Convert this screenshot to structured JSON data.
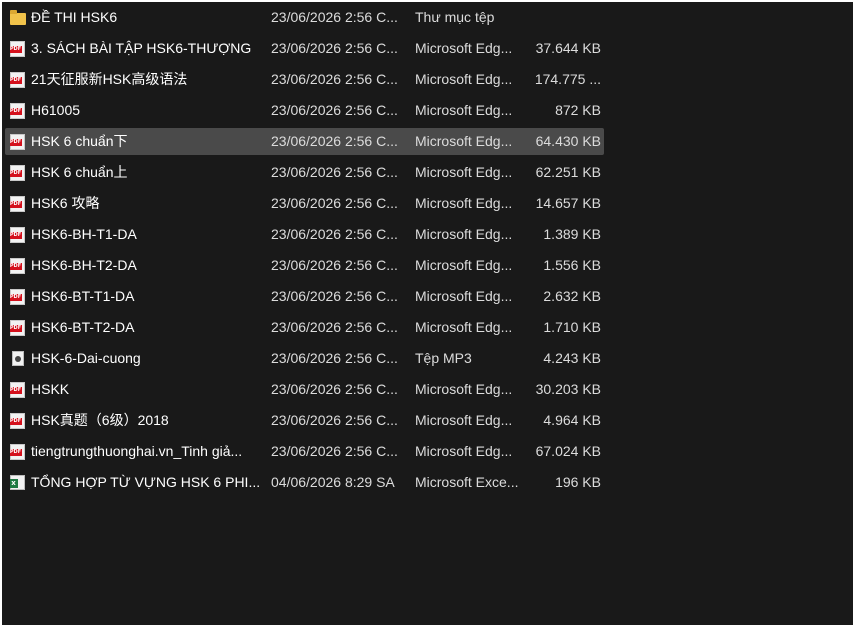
{
  "files": [
    {
      "name": "ĐỀ THI HSK6",
      "date": "23/06/2026 2:56 C...",
      "type": "Thư mục tệp",
      "size": "",
      "icon": "folder-icon"
    },
    {
      "name": "3. SÁCH BÀI TẬP HSK6-THƯỢNG",
      "date": "23/06/2026 2:56 C...",
      "type": "Microsoft Edg...",
      "size": "37.644 KB",
      "icon": "pdf-icon"
    },
    {
      "name": "21天征服新HSK高级语法",
      "date": "23/06/2026 2:56 C...",
      "type": "Microsoft Edg...",
      "size": "174.775 ...",
      "icon": "pdf-icon"
    },
    {
      "name": "H61005",
      "date": "23/06/2026 2:56 C...",
      "type": "Microsoft Edg...",
      "size": "872 KB",
      "icon": "pdf-icon"
    },
    {
      "name": "HSK 6  chuẩn下",
      "date": "23/06/2026 2:56 C...",
      "type": "Microsoft Edg...",
      "size": "64.430 KB",
      "icon": "pdf-icon",
      "selected": true
    },
    {
      "name": "HSK 6 chuẩn上",
      "date": "23/06/2026 2:56 C...",
      "type": "Microsoft Edg...",
      "size": "62.251 KB",
      "icon": "pdf-icon"
    },
    {
      "name": "HSK6 攻略",
      "date": "23/06/2026 2:56 C...",
      "type": "Microsoft Edg...",
      "size": "14.657 KB",
      "icon": "pdf-icon"
    },
    {
      "name": "HSK6-BH-T1-DA",
      "date": "23/06/2026 2:56 C...",
      "type": "Microsoft Edg...",
      "size": "1.389 KB",
      "icon": "pdf-icon"
    },
    {
      "name": "HSK6-BH-T2-DA",
      "date": "23/06/2026 2:56 C...",
      "type": "Microsoft Edg...",
      "size": "1.556 KB",
      "icon": "pdf-icon"
    },
    {
      "name": "HSK6-BT-T1-DA",
      "date": "23/06/2026 2:56 C...",
      "type": "Microsoft Edg...",
      "size": "2.632 KB",
      "icon": "pdf-icon"
    },
    {
      "name": "HSK6-BT-T2-DA",
      "date": "23/06/2026 2:56 C...",
      "type": "Microsoft Edg...",
      "size": "1.710 KB",
      "icon": "pdf-icon"
    },
    {
      "name": "HSK-6-Dai-cuong",
      "date": "23/06/2026 2:56 C...",
      "type": "Tệp MP3",
      "size": "4.243 KB",
      "icon": "mp3-icon"
    },
    {
      "name": "HSKK",
      "date": "23/06/2026 2:56 C...",
      "type": "Microsoft Edg...",
      "size": "30.203 KB",
      "icon": "pdf-icon"
    },
    {
      "name": "HSK真题（6级）2018",
      "date": "23/06/2026 2:56 C...",
      "type": "Microsoft Edg...",
      "size": "4.964 KB",
      "icon": "pdf-icon"
    },
    {
      "name": "tiengtrungthuonghai.vn_Tinh giả...",
      "date": "23/06/2026 2:56 C...",
      "type": "Microsoft Edg...",
      "size": "67.024 KB",
      "icon": "pdf-icon"
    },
    {
      "name": "TỔNG HỢP TỪ VỰNG HSK 6 PHI...",
      "date": "04/06/2026 8:29 SA",
      "type": "Microsoft Exce...",
      "size": "196 KB",
      "icon": "xlsx-icon"
    }
  ],
  "colors": {
    "background": "#191919",
    "selected_row": "#4a4a4a",
    "text": "#ffffff",
    "secondary_text": "#dcdcdc"
  }
}
